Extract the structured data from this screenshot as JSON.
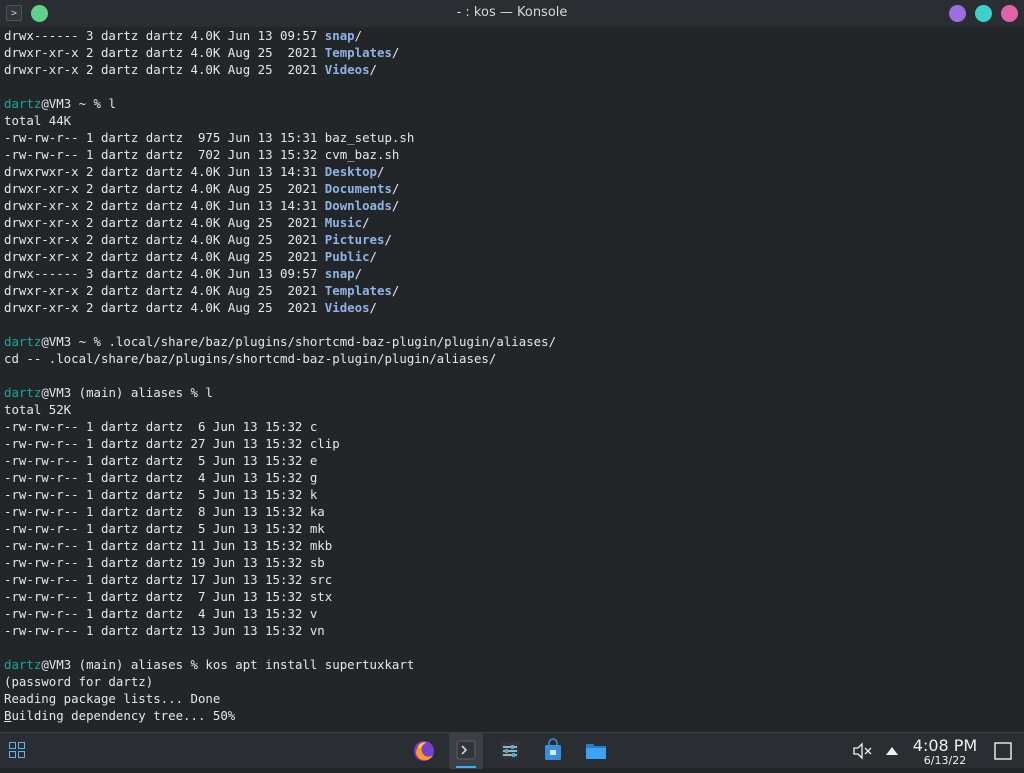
{
  "window": {
    "title": "- : kos — Konsole",
    "app_icon_glyph": ">",
    "pin_color": "#5fd18c",
    "button_colors": [
      "#9a6fe0",
      "#3fd0c9",
      "#e063a8"
    ]
  },
  "terminal": {
    "lines": [
      [
        [
          "drwx------ 3 dartz dartz 4.0K Jun 13 09:57 ",
          ""
        ],
        [
          "snap",
          "dir"
        ],
        [
          "/",
          ""
        ]
      ],
      [
        [
          "drwxr-xr-x 2 dartz dartz 4.0K Aug 25  2021 ",
          ""
        ],
        [
          "Templates",
          "dir"
        ],
        [
          "/",
          ""
        ]
      ],
      [
        [
          "drwxr-xr-x 2 dartz dartz 4.0K Aug 25  2021 ",
          ""
        ],
        [
          "Videos",
          "dir"
        ],
        [
          "/",
          ""
        ]
      ],
      [],
      [
        [
          "dartz",
          "usr"
        ],
        [
          "@VM3 ~ % l",
          ""
        ]
      ],
      [
        [
          "total 44K",
          ""
        ]
      ],
      [
        [
          "-rw-rw-r-- 1 dartz dartz  975 Jun 13 15:31 baz_setup.sh",
          ""
        ]
      ],
      [
        [
          "-rw-rw-r-- 1 dartz dartz  702 Jun 13 15:32 cvm_baz.sh",
          ""
        ]
      ],
      [
        [
          "drwxrwxr-x 2 dartz dartz 4.0K Jun 13 14:31 ",
          ""
        ],
        [
          "Desktop",
          "dir"
        ],
        [
          "/",
          ""
        ]
      ],
      [
        [
          "drwxr-xr-x 2 dartz dartz 4.0K Aug 25  2021 ",
          ""
        ],
        [
          "Documents",
          "dir"
        ],
        [
          "/",
          ""
        ]
      ],
      [
        [
          "drwxr-xr-x 2 dartz dartz 4.0K Jun 13 14:31 ",
          ""
        ],
        [
          "Downloads",
          "dir"
        ],
        [
          "/",
          ""
        ]
      ],
      [
        [
          "drwxr-xr-x 2 dartz dartz 4.0K Aug 25  2021 ",
          ""
        ],
        [
          "Music",
          "dir"
        ],
        [
          "/",
          ""
        ]
      ],
      [
        [
          "drwxr-xr-x 2 dartz dartz 4.0K Aug 25  2021 ",
          ""
        ],
        [
          "Pictures",
          "dir"
        ],
        [
          "/",
          ""
        ]
      ],
      [
        [
          "drwxr-xr-x 2 dartz dartz 4.0K Aug 25  2021 ",
          ""
        ],
        [
          "Public",
          "dir"
        ],
        [
          "/",
          ""
        ]
      ],
      [
        [
          "drwx------ 3 dartz dartz 4.0K Jun 13 09:57 ",
          ""
        ],
        [
          "snap",
          "dir"
        ],
        [
          "/",
          ""
        ]
      ],
      [
        [
          "drwxr-xr-x 2 dartz dartz 4.0K Aug 25  2021 ",
          ""
        ],
        [
          "Templates",
          "dir"
        ],
        [
          "/",
          ""
        ]
      ],
      [
        [
          "drwxr-xr-x 2 dartz dartz 4.0K Aug 25  2021 ",
          ""
        ],
        [
          "Videos",
          "dir"
        ],
        [
          "/",
          ""
        ]
      ],
      [],
      [
        [
          "dartz",
          "usr"
        ],
        [
          "@VM3 ~ % .local/share/baz/plugins/shortcmd-baz-plugin/plugin/aliases/",
          ""
        ]
      ],
      [
        [
          "cd -- .local/share/baz/plugins/shortcmd-baz-plugin/plugin/aliases/",
          ""
        ]
      ],
      [],
      [
        [
          "dartz",
          "usr"
        ],
        [
          "@VM3 (main) aliases % l",
          ""
        ]
      ],
      [
        [
          "total 52K",
          ""
        ]
      ],
      [
        [
          "-rw-rw-r-- 1 dartz dartz  6 Jun 13 15:32 c",
          ""
        ]
      ],
      [
        [
          "-rw-rw-r-- 1 dartz dartz 27 Jun 13 15:32 clip",
          ""
        ]
      ],
      [
        [
          "-rw-rw-r-- 1 dartz dartz  5 Jun 13 15:32 e",
          ""
        ]
      ],
      [
        [
          "-rw-rw-r-- 1 dartz dartz  4 Jun 13 15:32 g",
          ""
        ]
      ],
      [
        [
          "-rw-rw-r-- 1 dartz dartz  5 Jun 13 15:32 k",
          ""
        ]
      ],
      [
        [
          "-rw-rw-r-- 1 dartz dartz  8 Jun 13 15:32 ka",
          ""
        ]
      ],
      [
        [
          "-rw-rw-r-- 1 dartz dartz  5 Jun 13 15:32 mk",
          ""
        ]
      ],
      [
        [
          "-rw-rw-r-- 1 dartz dartz 11 Jun 13 15:32 mkb",
          ""
        ]
      ],
      [
        [
          "-rw-rw-r-- 1 dartz dartz 19 Jun 13 15:32 sb",
          ""
        ]
      ],
      [
        [
          "-rw-rw-r-- 1 dartz dartz 17 Jun 13 15:32 src",
          ""
        ]
      ],
      [
        [
          "-rw-rw-r-- 1 dartz dartz  7 Jun 13 15:32 stx",
          ""
        ]
      ],
      [
        [
          "-rw-rw-r-- 1 dartz dartz  4 Jun 13 15:32 v",
          ""
        ]
      ],
      [
        [
          "-rw-rw-r-- 1 dartz dartz 13 Jun 13 15:32 vn",
          ""
        ]
      ],
      [],
      [
        [
          "dartz",
          "usr"
        ],
        [
          "@VM3 (main) aliases % kos apt install supertuxkart",
          ""
        ]
      ],
      [
        [
          "(password for dartz)",
          ""
        ]
      ],
      [
        [
          "Reading package lists... Done",
          ""
        ]
      ],
      [
        [
          "B",
          "cursor"
        ],
        [
          "uilding dependency tree... 50%",
          ""
        ]
      ]
    ]
  },
  "taskbar": {
    "launcher_icon": "app-grid-icon",
    "tasks": [
      {
        "name": "firefox",
        "icon": "firefox-icon",
        "active": false
      },
      {
        "name": "konsole",
        "icon": "terminal-icon",
        "active": true
      },
      {
        "name": "system-settings",
        "icon": "settings-sliders-icon",
        "active": false
      },
      {
        "name": "discover",
        "icon": "store-bag-icon",
        "active": false
      },
      {
        "name": "dolphin",
        "icon": "folder-icon",
        "active": false
      }
    ],
    "tray": {
      "volume_icon": "volume-muted-icon",
      "arrow_icon": "tray-expand-icon",
      "desktop_icon": "show-desktop-icon"
    },
    "clock": {
      "time": "4:08 PM",
      "date": "6/13/22"
    }
  }
}
